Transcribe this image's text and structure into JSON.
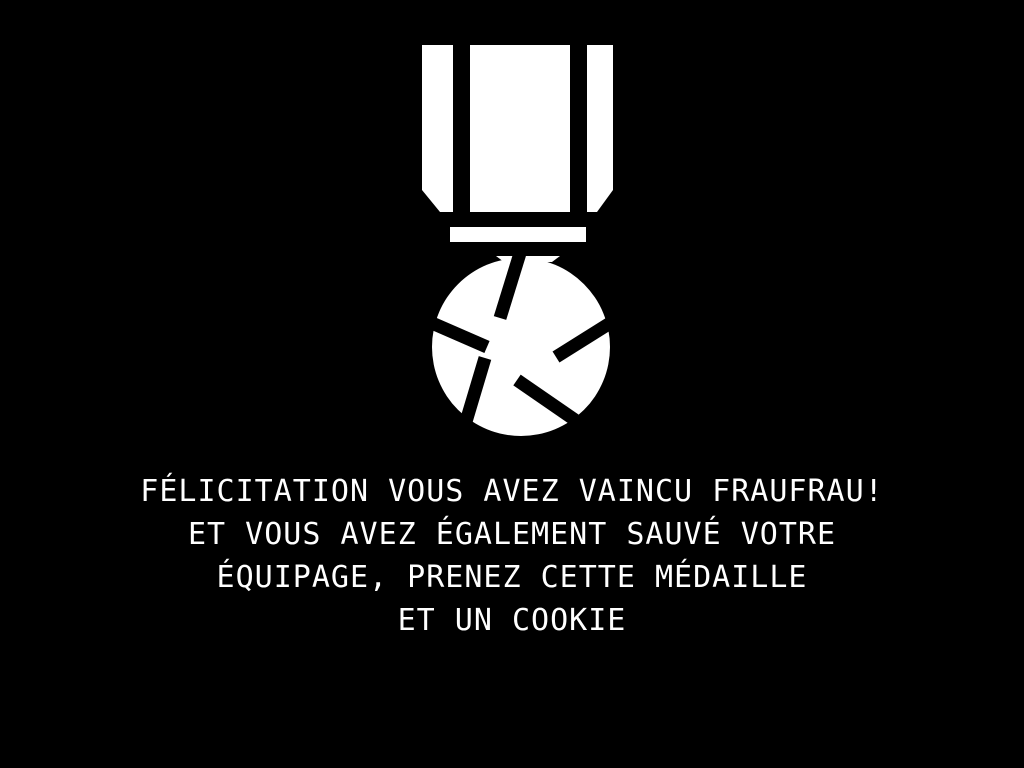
{
  "screen": {
    "background_color": "#000000",
    "foreground_color": "#ffffff",
    "medal_icon": "medal-icon"
  },
  "message": {
    "lines": [
      "FÉLICITATION VOUS AVEZ VAINCU FRAUFRAU!",
      "ET VOUS AVEZ ÉGALEMENT SAUVÉ VOTRE",
      "ÉQUIPAGE, PRENEZ CETTE MÉDAILLE",
      "ET UN COOKIE"
    ]
  }
}
